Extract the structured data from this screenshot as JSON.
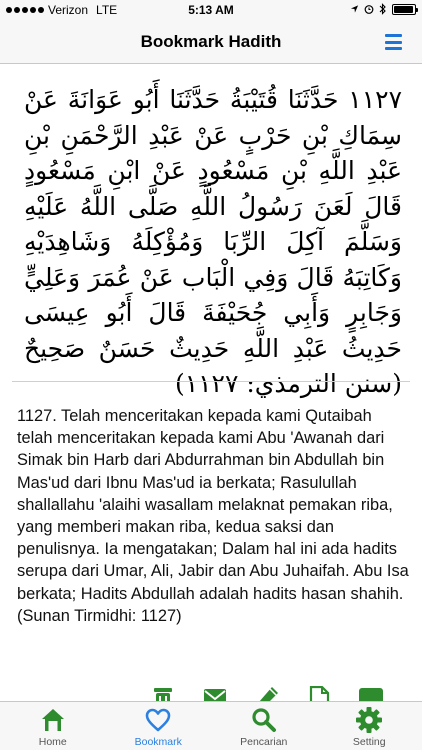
{
  "status_bar": {
    "carrier": "Verizon",
    "network": "LTE",
    "time": "5:13 AM",
    "battery_level": 0.95
  },
  "header": {
    "title": "Bookmark Hadith",
    "menu_icon": "hamburger-menu-icon"
  },
  "hadith": {
    "arabic": "١١٢٧ حَدَّثَنَا قُتَيْبَةُ حَدَّثَنَا أَبُو عَوَانَةَ عَنْ سِمَاكِ بْنِ حَرْبٍ عَنْ عَبْدِ الرَّحْمَنِ بْنِ عَبْدِ اللَّهِ بْنِ مَسْعُودٍ عَنْ ابْنِ مَسْعُودٍ قَالَ لَعَنَ رَسُولُ اللَّهِ صَلَّى اللَّهُ عَلَيْهِ وَسَلَّمَ آكِلَ الرِّبَا وَمُؤْكِلَهُ وَشَاهِدَيْهِ وَكَاتِبَهُ قَالَ وَفِي الْبَاب عَنْ عُمَرَ وَعَلِيٍّ وَجَابِرٍ وَأَبِي جُحَيْفَةَ قَالَ أَبُو عِيسَى حَدِيثُ عَبْدِ اللَّهِ حَدِيثٌ حَسَنٌ صَحِيحٌ (سنن الترمذي: ١١٢٧)",
    "translation": "1127. Telah menceritakan kepada kami Qutaibah telah menceritakan kepada kami Abu 'Awanah dari Simak bin Harb dari Abdurrahman bin Abdullah bin Mas'ud dari Ibnu Mas'ud ia berkata; Rasulullah shallallahu 'alaihi wasallam melaknat pemakan riba, yang memberi makan riba, kedua saksi dan penulisnya. Ia mengatakan; Dalam hal ini ada hadits serupa dari Umar, Ali, Jabir dan Abu Juhaifah. Abu Isa berkata; Hadits Abdullah adalah hadits hasan shahih. (Sunan Tirmidhi: 1127)"
  },
  "actions": [
    "delete-icon",
    "email-icon",
    "edit-icon",
    "copy-icon",
    "message-icon"
  ],
  "tabs": [
    {
      "label": "Home",
      "icon": "home-icon",
      "active": false
    },
    {
      "label": "Bookmark",
      "icon": "heart-icon",
      "active": true
    },
    {
      "label": "Pencarian",
      "icon": "search-icon",
      "active": false
    },
    {
      "label": "Setting",
      "icon": "gear-icon",
      "active": false
    }
  ],
  "colors": {
    "accent_green": "#2e8b2e",
    "accent_blue": "#2b80e0",
    "bar_background": "#f7f7f7"
  }
}
